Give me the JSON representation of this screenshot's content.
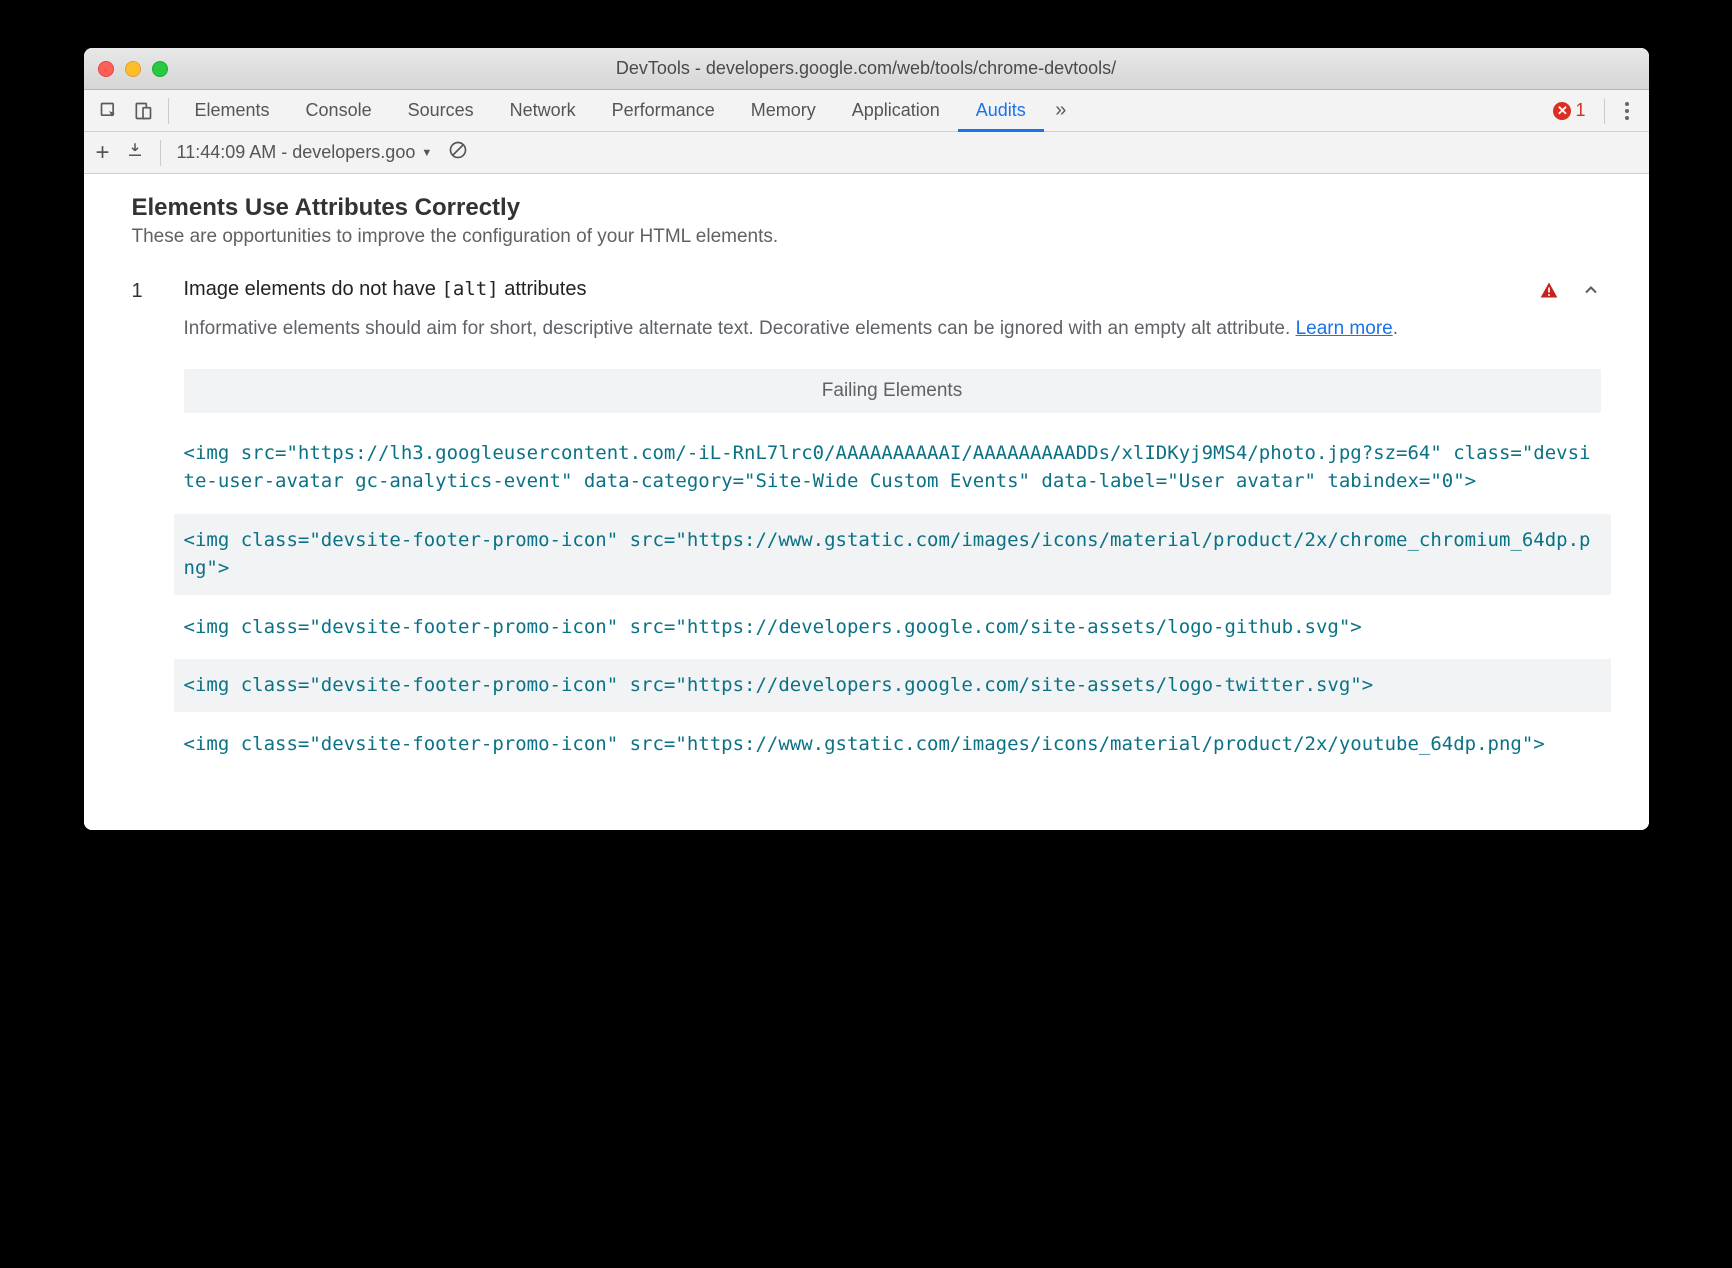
{
  "window": {
    "title": "DevTools - developers.google.com/web/tools/chrome-devtools/"
  },
  "tabs": {
    "items": [
      "Elements",
      "Console",
      "Sources",
      "Network",
      "Performance",
      "Memory",
      "Application",
      "Audits"
    ],
    "active": "Audits",
    "overflow_glyph": "»",
    "error_count": "1"
  },
  "subbar": {
    "plus": "+",
    "selected": "11:44:09 AM - developers.goo"
  },
  "section": {
    "title": "Elements Use Attributes Correctly",
    "subtitle": "These are opportunities to improve the configuration of your HTML elements."
  },
  "audit": {
    "index": "1",
    "msg_pre": "Image elements do not have ",
    "msg_code": "[alt]",
    "msg_post": " attributes",
    "desc_pre": "Informative elements should aim for short, descriptive alternate text. Decorative elements can be ignored with an empty alt attribute. ",
    "learn_more": "Learn more",
    "desc_post": ".",
    "failing_header": "Failing Elements",
    "failing": [
      "<img src=\"https://lh3.googleusercontent.com/-iL-RnL7lrc0/AAAAAAAAAAI/AAAAAAAAADDs/xlIDKyj9MS4/photo.jpg?sz=64\" class=\"devsite-user-avatar gc-analytics-event\" data-category=\"Site-Wide Custom Events\" data-label=\"User avatar\" tabindex=\"0\">",
      "<img class=\"devsite-footer-promo-icon\" src=\"https://www.gstatic.com/images/icons/material/product/2x/chrome_chromium_64dp.png\">",
      "<img class=\"devsite-footer-promo-icon\" src=\"https://developers.google.com/site-assets/logo-github.svg\">",
      "<img class=\"devsite-footer-promo-icon\" src=\"https://developers.google.com/site-assets/logo-twitter.svg\">",
      "<img class=\"devsite-footer-promo-icon\" src=\"https://www.gstatic.com/images/icons/material/product/2x/youtube_64dp.png\">"
    ]
  }
}
